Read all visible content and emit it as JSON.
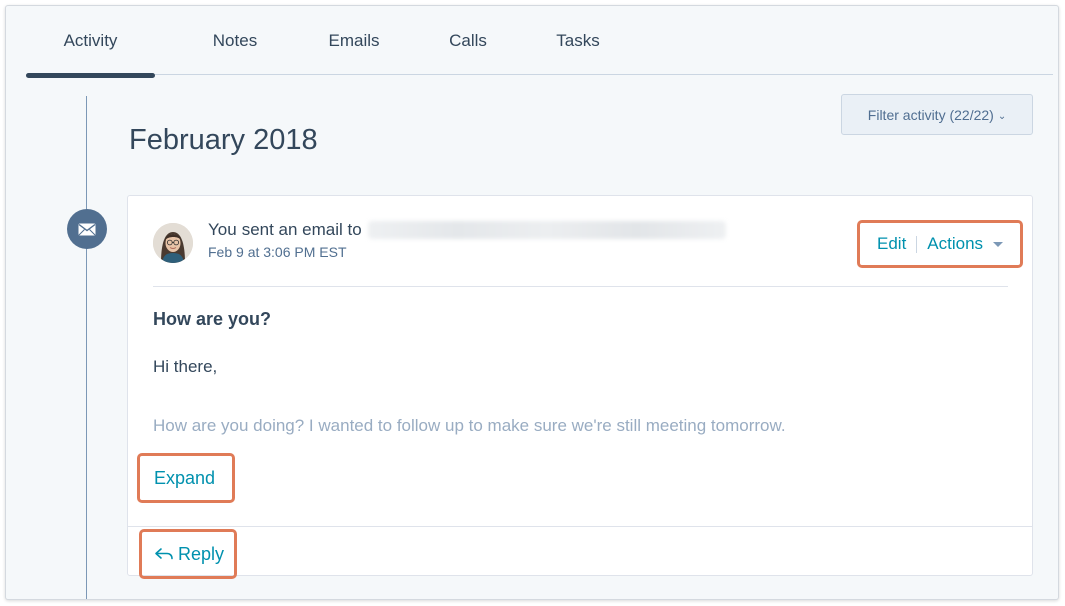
{
  "tabs": [
    {
      "label": "Activity",
      "active": true
    },
    {
      "label": "Notes",
      "active": false
    },
    {
      "label": "Emails",
      "active": false
    },
    {
      "label": "Calls",
      "active": false
    },
    {
      "label": "Tasks",
      "active": false
    }
  ],
  "timeline": {
    "month": "February 2018",
    "icon": "envelope-icon"
  },
  "filter": {
    "label": "Filter activity (22/22)",
    "caret": "⌄"
  },
  "email_card": {
    "actor": "You",
    "action": "sent an email to",
    "timestamp": "Feb 9 at 3:06 PM EST",
    "edit_label": "Edit",
    "actions_label": "Actions",
    "subject": "How are you?",
    "greeting": "Hi there,",
    "preview": "How are you doing? I wanted to follow up to make sure we're still meeting tomorrow.",
    "expand_label": "Expand",
    "reply_label": "Reply",
    "reply_icon": "←"
  },
  "colors": {
    "accent": "#0091ae",
    "highlight_border": "#e07b57",
    "text": "#33475b",
    "muted_text": "#99acc2",
    "timeline_icon_bg": "#516f90"
  }
}
